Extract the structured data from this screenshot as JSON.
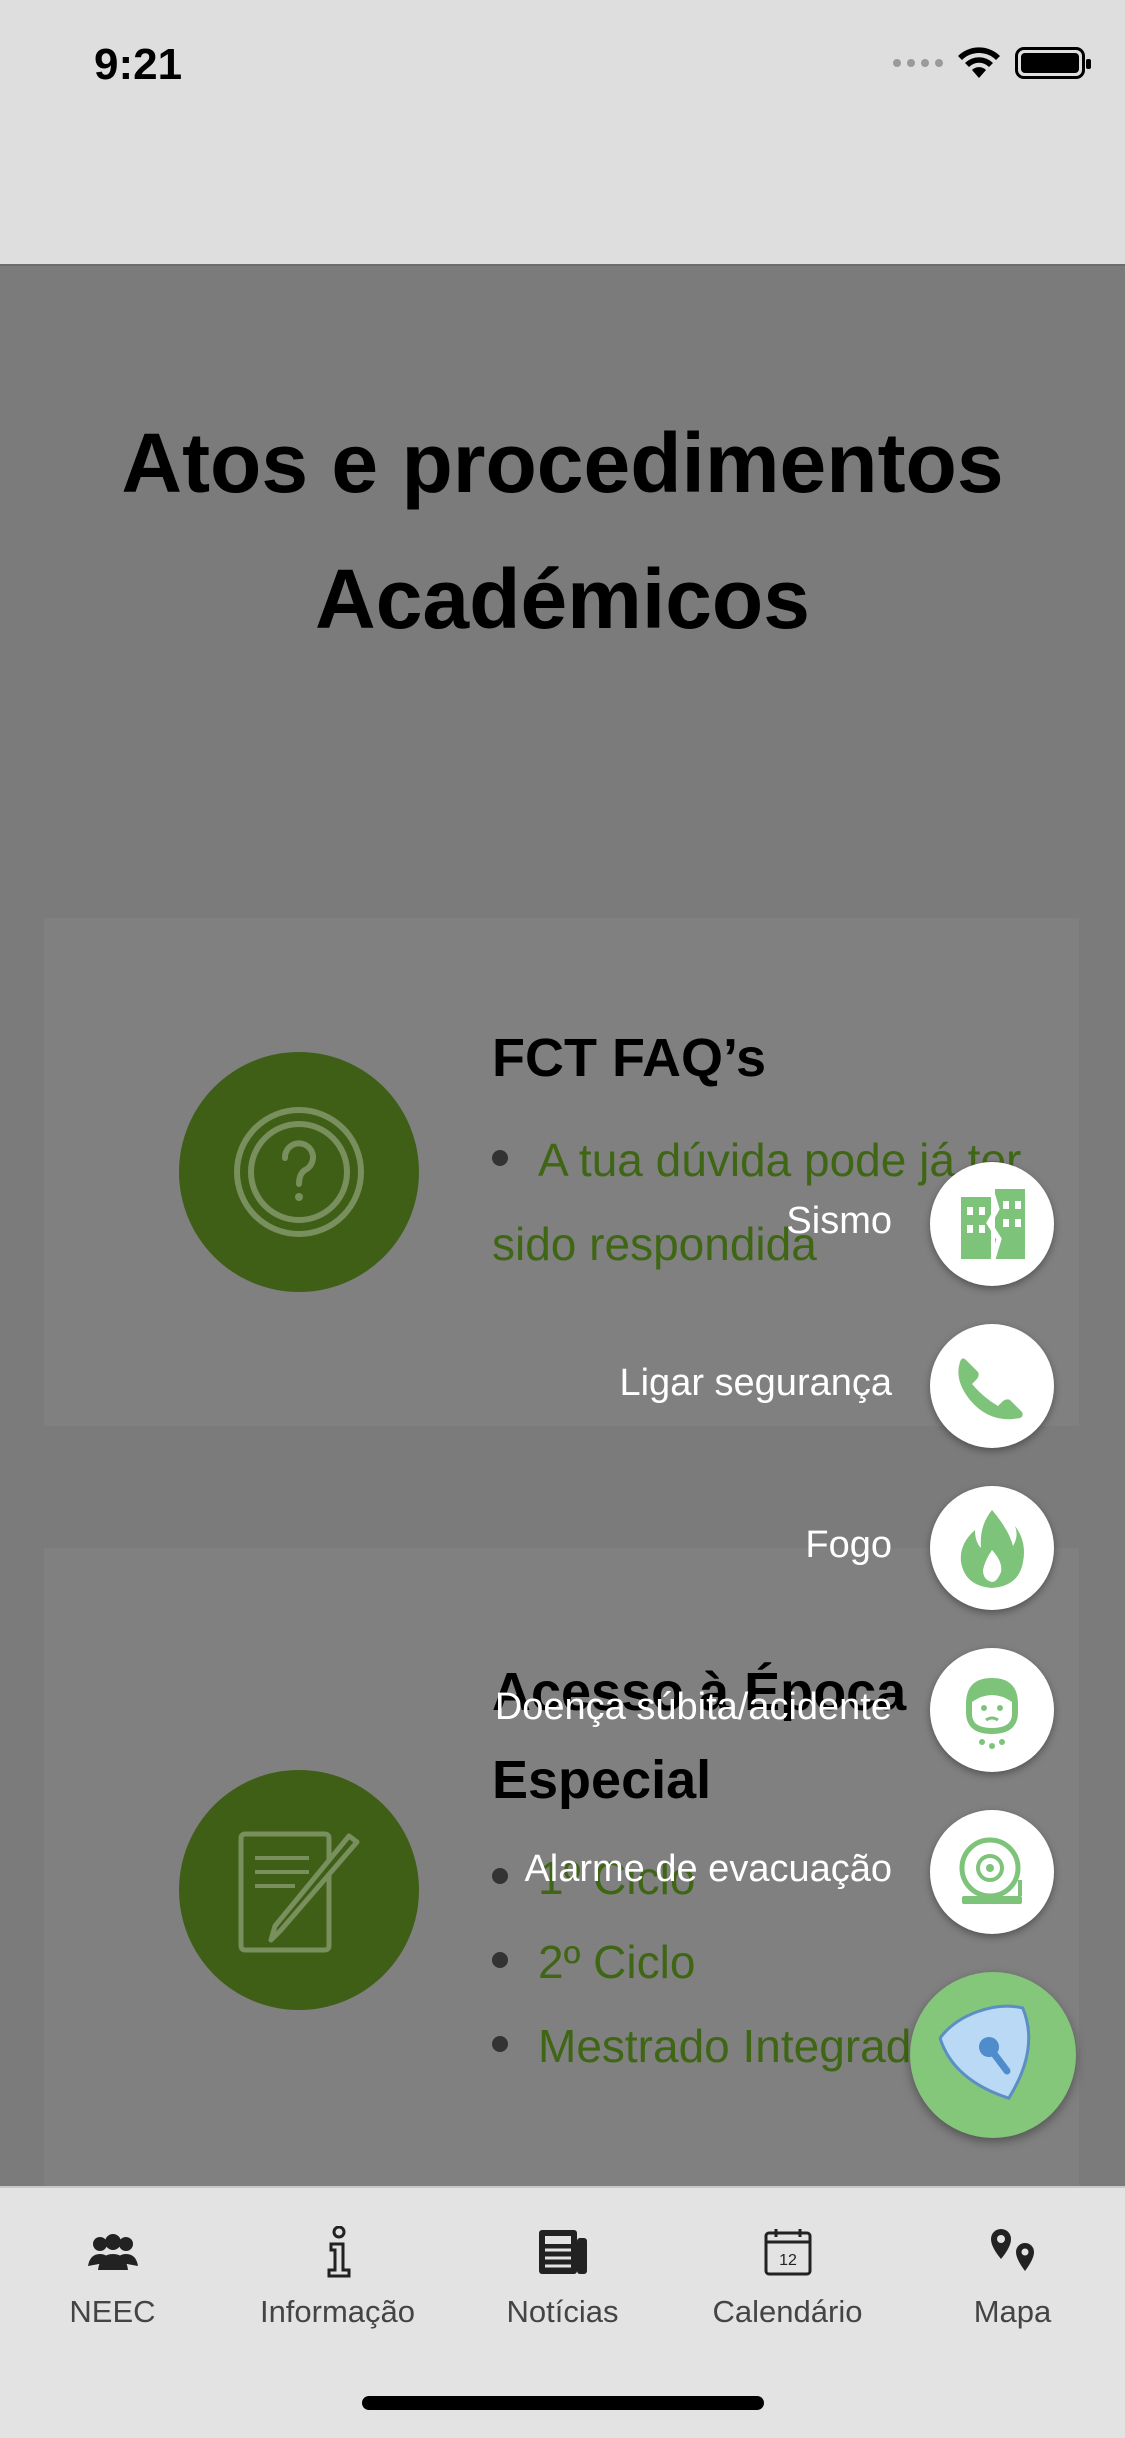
{
  "status_bar": {
    "time": "9:21"
  },
  "page": {
    "title": "Atos e procedimentos Académicos"
  },
  "cards": [
    {
      "title": "FCT FAQ’s",
      "icon": "question-icon",
      "items": [
        "A tua dúvida pode já ter sido respondida"
      ]
    },
    {
      "title": "Acesso à Época Especial",
      "icon": "pencil-document-icon",
      "items": [
        "1º Ciclo",
        "2º Ciclo",
        "Mestrado Integrado"
      ]
    }
  ],
  "emergency_menu": {
    "options": [
      {
        "label": "Sismo",
        "icon": "earthquake-building-icon"
      },
      {
        "label": "Ligar segurança",
        "icon": "phone-icon"
      },
      {
        "label": "Fogo",
        "icon": "fire-icon"
      },
      {
        "label": "Doença súbita/acidente",
        "icon": "sick-person-icon"
      },
      {
        "label": "Alarme de evacuação",
        "icon": "alarm-bell-icon"
      }
    ],
    "main_button_icon": "shield-key-icon"
  },
  "tabs": [
    {
      "label": "NEEC",
      "icon": "group-icon"
    },
    {
      "label": "Informação",
      "icon": "info-icon"
    },
    {
      "label": "Notícias",
      "icon": "newspaper-icon"
    },
    {
      "label": "Calendário",
      "icon": "calendar-icon",
      "day": "12"
    },
    {
      "label": "Mapa",
      "icon": "map-pins-icon"
    }
  ],
  "colors": {
    "accent_green": "#84c67a",
    "card_circle": "#3f5f17",
    "link_green": "#3f6614",
    "overlay": "#7b7b7b"
  }
}
